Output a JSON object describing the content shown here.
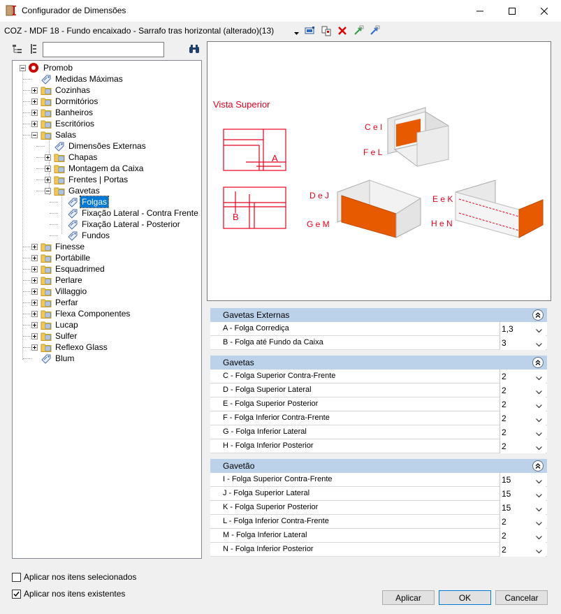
{
  "window": {
    "title": "Configurador de Dimensões",
    "minimize_icon": "minimize-icon",
    "maximize_icon": "maximize-icon",
    "close_icon": "close-icon"
  },
  "toolbar": {
    "item_title": "COZ - MDF 18 - Fundo encaixado - Sarrafo tras horizontal (alterado)(13)"
  },
  "tree": {
    "root": "Promob",
    "nodes": [
      {
        "label": "Medidas Máximas"
      },
      {
        "label": "Cozinhas"
      },
      {
        "label": "Dormitórios"
      },
      {
        "label": "Banheiros"
      },
      {
        "label": "Escritórios"
      },
      {
        "label": "Salas"
      },
      {
        "label": "Dimensões Externas"
      },
      {
        "label": "Chapas"
      },
      {
        "label": "Montagem da Caixa"
      },
      {
        "label": "Frentes | Portas"
      },
      {
        "label": "Gavetas"
      },
      {
        "label": "Folgas"
      },
      {
        "label": "Fixação Lateral - Contra Frente"
      },
      {
        "label": "Fixação Lateral - Posterior"
      },
      {
        "label": "Fundos"
      },
      {
        "label": "Finesse"
      },
      {
        "label": "Portábille"
      },
      {
        "label": "Esquadrimed"
      },
      {
        "label": "Perlare"
      },
      {
        "label": "Villaggio"
      },
      {
        "label": "Perfar"
      },
      {
        "label": "Flexa Componentes"
      },
      {
        "label": "Lucap"
      },
      {
        "label": "Sulfer"
      },
      {
        "label": "Reflexo Glass"
      },
      {
        "label": "Blum"
      }
    ]
  },
  "preview": {
    "vista_superior": "Vista Superior",
    "label_A": "A",
    "label_B": "B",
    "label_CeI": "C e I",
    "label_FeL": "F e L",
    "label_DeJ": "D e J",
    "label_GeM": "G e M",
    "label_EeK": "E e K",
    "label_HeN": "H e N",
    "accent": "#e8001c",
    "panel_color": "#e85a00"
  },
  "sections": [
    {
      "title": "Gavetas Externas",
      "rows": [
        {
          "label": "A - Folga Corrediça",
          "value": "1,3"
        },
        {
          "label": "B - Folga até Fundo da Caixa",
          "value": "3"
        }
      ]
    },
    {
      "title": "Gavetas",
      "rows": [
        {
          "label": "C - Folga Superior Contra-Frente",
          "value": "2"
        },
        {
          "label": "D - Folga Superior Lateral",
          "value": "2"
        },
        {
          "label": "E - Folga Superior Posterior",
          "value": "2"
        },
        {
          "label": "F - Folga Inferior Contra-Frente",
          "value": "2"
        },
        {
          "label": "G - Folga Inferior Lateral",
          "value": "2"
        },
        {
          "label": "H - Folga Inferior Posterior",
          "value": "2"
        }
      ]
    },
    {
      "title": "Gavetão",
      "rows": [
        {
          "label": "I - Folga Superior Contra-Frente",
          "value": "15"
        },
        {
          "label": "J - Folga Superior Lateral",
          "value": "15"
        },
        {
          "label": "K - Folga Superior Posterior",
          "value": "15"
        },
        {
          "label": "L - Folga Inferior Contra-Frente",
          "value": "2"
        },
        {
          "label": "M - Folga Inferior Lateral",
          "value": "2"
        },
        {
          "label": "N - Folga Inferior Posterior",
          "value": "2"
        }
      ]
    }
  ],
  "options": {
    "apply_selected": "Aplicar nos itens selecionados",
    "apply_selected_checked": false,
    "apply_existing": "Aplicar nos itens existentes",
    "apply_existing_checked": true
  },
  "buttons": {
    "apply": "Aplicar",
    "ok": "OK",
    "cancel": "Cancelar"
  }
}
